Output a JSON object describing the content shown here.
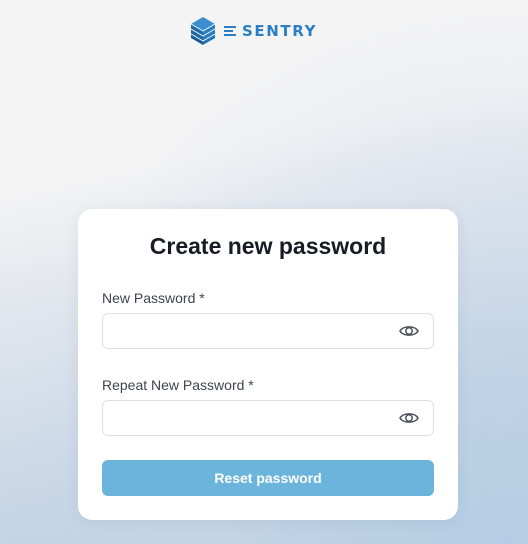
{
  "brand": {
    "name": "E SENTRY",
    "name_rest": "SENTRY",
    "logo_icon": "stacked-cubes-logo-icon",
    "color": "#2a7fc4"
  },
  "card": {
    "title": "Create new password",
    "new_password": {
      "label": "New Password *",
      "value": "",
      "placeholder": "",
      "toggle_icon": "eye-icon"
    },
    "repeat_password": {
      "label": "Repeat New Password *",
      "value": "",
      "placeholder": "",
      "toggle_icon": "eye-icon"
    },
    "submit_label": "Reset password",
    "submit_color": "#6bb4dc"
  }
}
